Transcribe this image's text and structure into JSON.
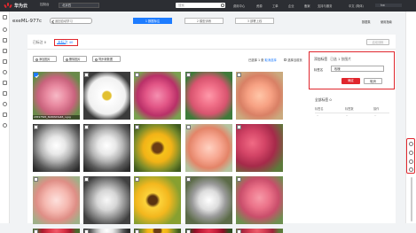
{
  "topbar": {
    "brand": "华为云",
    "region": "控制台",
    "project": "北京四",
    "search_placeholder": "搜索",
    "nav": [
      "费用中心",
      "资源",
      "工单",
      "企业",
      "备案",
      "支持与服务",
      "中文 (简体)",
      "hw"
    ]
  },
  "page": {
    "title": "exeML-977c",
    "back_label": "返回自动学习",
    "steps": [
      "1 数据标注",
      "2 模型训练",
      "3 部署上线"
    ],
    "right_links": [
      "数据集",
      "使用指南"
    ]
  },
  "main": {
    "tabs": [
      "已标注 0",
      "未标注 40"
    ],
    "right_button": "启动训练",
    "actions": [
      "添加图片",
      "删除图片",
      "同步新数据"
    ],
    "selected_text": "已选择 1 张",
    "cancel_select": "取消选择",
    "select_all": "选择当前页"
  },
  "images": [
    {
      "fn": "20597595_3b893d3e65_n.jpg",
      "checked": true,
      "theme": "rose-pink"
    },
    {
      "fn": "",
      "checked": false,
      "theme": "daisy"
    },
    {
      "fn": "",
      "checked": false,
      "theme": "rose-dpink"
    },
    {
      "fn": "",
      "checked": false,
      "theme": "rose-green"
    },
    {
      "fn": "",
      "checked": false,
      "theme": "rose-salmon"
    },
    {
      "fn": "",
      "checked": false,
      "theme": "dandelion"
    },
    {
      "fn": "",
      "checked": false,
      "theme": "dandelion"
    },
    {
      "fn": "",
      "checked": false,
      "theme": "sunflower"
    },
    {
      "fn": "",
      "checked": false,
      "theme": "rose-salmon2"
    },
    {
      "fn": "",
      "checked": false,
      "theme": "rose-bunch"
    },
    {
      "fn": "",
      "checked": false,
      "theme": "rose-pale"
    },
    {
      "fn": "",
      "checked": false,
      "theme": "dandelion2"
    },
    {
      "fn": "",
      "checked": false,
      "theme": "sunflower2"
    },
    {
      "fn": "",
      "checked": false,
      "theme": "dandelion3"
    },
    {
      "fn": "",
      "checked": false,
      "theme": "rose-bunch2"
    },
    {
      "fn": "",
      "checked": false,
      "theme": "rose-red"
    },
    {
      "fn": "",
      "checked": false,
      "theme": "dandelion"
    },
    {
      "fn": "",
      "checked": false,
      "theme": "sunflower"
    },
    {
      "fn": "",
      "checked": false,
      "theme": "rose-crimson"
    },
    {
      "fn": "",
      "checked": false,
      "theme": "rose-bunch3"
    }
  ],
  "panel": {
    "title": "添加标签",
    "count_text": "已选 1 张图片",
    "label": "标签名",
    "value": "玫瑰",
    "ok": "确定",
    "cancel": "取消"
  },
  "all_tags": {
    "title": "全部标签 0",
    "headers": [
      "标签名",
      "标签数",
      "操作"
    ],
    "empty": [
      "--",
      "--",
      "--"
    ]
  }
}
